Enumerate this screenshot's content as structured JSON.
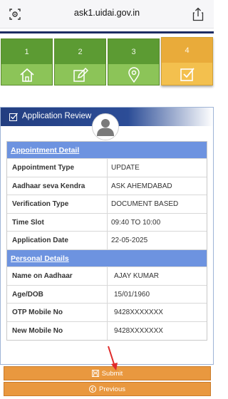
{
  "browser": {
    "url": "ask1.uidai.gov.in"
  },
  "steps": [
    {
      "number": "1",
      "icon": "home-icon"
    },
    {
      "number": "2",
      "icon": "edit-icon"
    },
    {
      "number": "3",
      "icon": "location-pin-icon"
    },
    {
      "number": "4",
      "icon": "check-square-icon",
      "active": true
    }
  ],
  "colors": {
    "step_done": "#5c9b33",
    "step_active": "#e9ab3a",
    "header_blue": "#233e80",
    "section_blue": "#6d93e0",
    "button_orange": "#e9983f"
  },
  "review": {
    "title": "Application Review",
    "appointment_section": "Appointment Detail",
    "appointment_rows": [
      {
        "label": "Appointment Type",
        "value": "UPDATE"
      },
      {
        "label": "Aadhaar seva Kendra",
        "value": "ASK AHEMDABAD"
      },
      {
        "label": "Verification Type",
        "value": "DOCUMENT BASED"
      },
      {
        "label": "Time Slot",
        "value": "09:40 TO 10:00"
      },
      {
        "label": "Application Date",
        "value": "22-05-2025"
      }
    ],
    "personal_section": "Personal Details",
    "personal_rows": [
      {
        "label": "Name on Aadhaar",
        "value": "AJAY KUMAR"
      },
      {
        "label": "Age/DOB",
        "value": "15/01/1960"
      },
      {
        "label": "OTP Mobile No",
        "value": "9428XXXXXXX"
      },
      {
        "label": "New Mobile No",
        "value": "9428XXXXXXX"
      }
    ]
  },
  "actions": {
    "submit_label": "Submit",
    "previous_label": "Previous"
  }
}
